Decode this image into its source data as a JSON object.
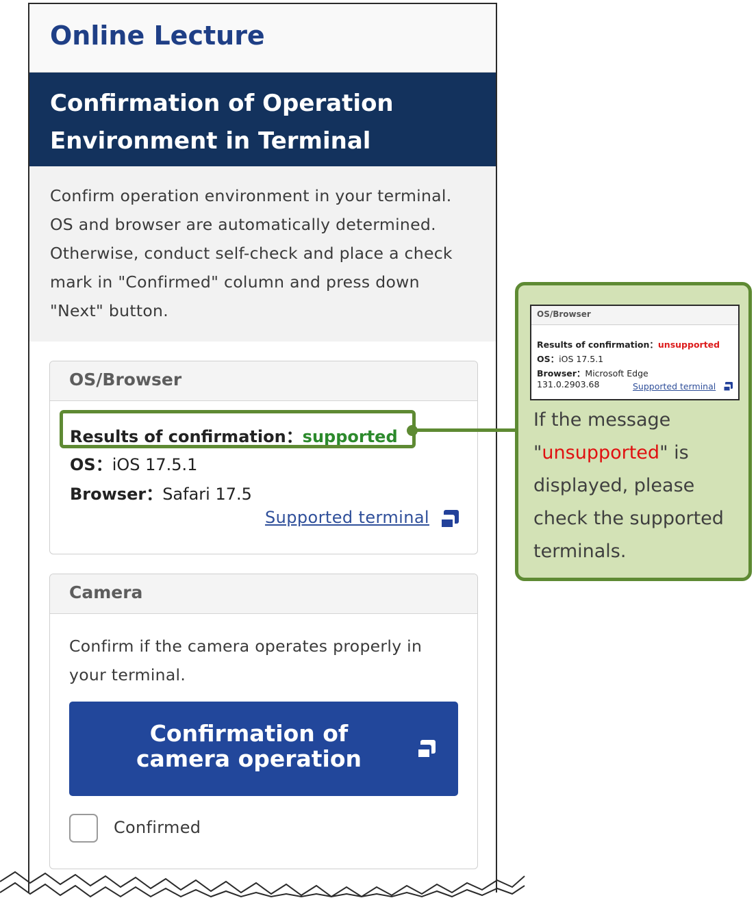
{
  "app": {
    "title": "Online Lecture"
  },
  "section": {
    "title": "Confirmation of Operation Environment in Terminal"
  },
  "intro": {
    "text": "Confirm operation environment in your terminal. OS and browser are automatically determined. Otherwise, conduct self-check and place a check mark in \"Confirmed\" column and press down \"Next\" button."
  },
  "os_card": {
    "header": "OS/Browser",
    "result_label": "Results of confirmation：",
    "result_value": "supported",
    "os_label": "OS：",
    "os_value": "iOS 17.5.1",
    "browser_label": "Browser：",
    "browser_value": "Safari 17.5",
    "supported_link": "Supported terminal",
    "link_icon": "new-window-icon"
  },
  "camera_card": {
    "header": "Camera",
    "text": "Confirm if the camera operates properly in your terminal.",
    "button_line1": "Confirmation of",
    "button_line2": "camera operation",
    "button_icon": "new-window-icon",
    "checkbox_label": "Confirmed",
    "checkbox_checked": false
  },
  "callout": {
    "mini": {
      "header": "OS/Browser",
      "result_label": "Results of confirmation：",
      "result_value": "unsupported",
      "os_label": "OS：",
      "os_value": "iOS 17.5.1",
      "browser_label": "Browser：",
      "browser_value": "Microsoft Edge",
      "browser_version": "131.0.2903.68",
      "supported_link": "Supported terminal"
    },
    "text_before": "If the message \"",
    "text_highlight": "unsupported",
    "text_after": "\" is displayed, please check the supported terminals."
  },
  "colors": {
    "header_title": "#1f3f86",
    "banner": "#13325d",
    "supported": "#2c8a2c",
    "unsupported": "#dd1c1c",
    "button": "#22479b",
    "callout_bg": "#d3e2b6",
    "callout_border": "#5e8a33"
  }
}
